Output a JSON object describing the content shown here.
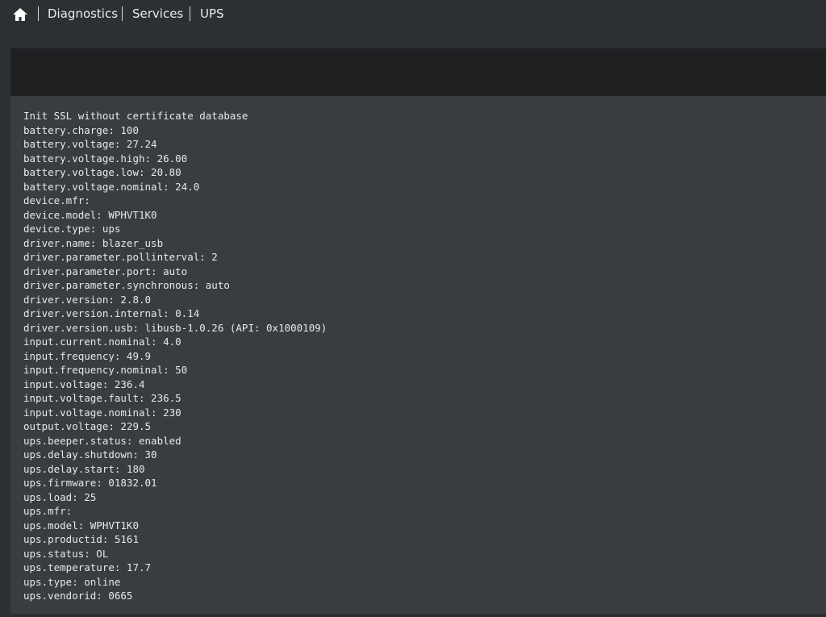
{
  "breadcrumb": {
    "home_icon": "home-icon",
    "items": [
      "Diagnostics",
      "Services",
      "UPS"
    ]
  },
  "output": {
    "lines": [
      "Init SSL without certificate database",
      "battery.charge: 100",
      "battery.voltage: 27.24",
      "battery.voltage.high: 26.00",
      "battery.voltage.low: 20.80",
      "battery.voltage.nominal: 24.0",
      "device.mfr:",
      "device.model: WPHVT1K0",
      "device.type: ups",
      "driver.name: blazer_usb",
      "driver.parameter.pollinterval: 2",
      "driver.parameter.port: auto",
      "driver.parameter.synchronous: auto",
      "driver.version: 2.8.0",
      "driver.version.internal: 0.14",
      "driver.version.usb: libusb-1.0.26 (API: 0x1000109)",
      "input.current.nominal: 4.0",
      "input.frequency: 49.9",
      "input.frequency.nominal: 50",
      "input.voltage: 236.4",
      "input.voltage.fault: 236.5",
      "input.voltage.nominal: 230",
      "output.voltage: 229.5",
      "ups.beeper.status: enabled",
      "ups.delay.shutdown: 30",
      "ups.delay.start: 180",
      "ups.firmware: 01832.01",
      "ups.load: 25",
      "ups.mfr:",
      "ups.model: WPHVT1K0",
      "ups.productid: 5161",
      "ups.status: OL",
      "ups.temperature: 17.7",
      "ups.type: online",
      "ups.vendorid: 0665"
    ]
  }
}
